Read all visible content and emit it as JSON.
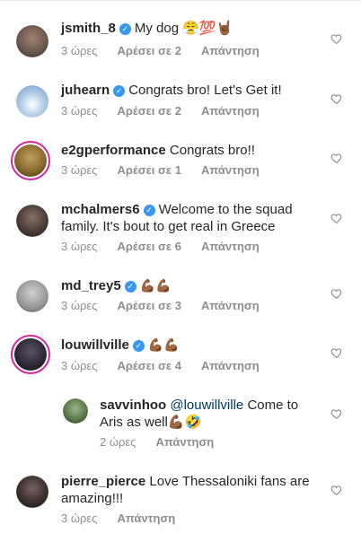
{
  "comments": [
    {
      "username": "jsmith_8",
      "verified": true,
      "text": "My dog 😤💯🤘🏾",
      "time": "3 ώρες",
      "likes": "Αρέσει σε 2",
      "reply": "Απάντηση",
      "avatar_color": "#6b5a4e"
    },
    {
      "username": "juhearn",
      "verified": true,
      "text": "Congrats bro! Let's Get it!",
      "time": "3 ώρες",
      "likes": "Αρέσει σε 2",
      "reply": "Απάντηση",
      "avatar_color": "#8fb3d9"
    },
    {
      "username": "e2gperformance",
      "verified": false,
      "text": "Congrats bro!!",
      "time": "3 ώρες",
      "likes": "Αρέσει σε 1",
      "reply": "Απάντηση",
      "avatar_color": "#8a6a2e"
    },
    {
      "username": "mchalmers6",
      "verified": true,
      "text": "Welcome to the squad family. It's bout to get real in Greece",
      "time": "3 ώρες",
      "likes": "Αρέσει σε 6",
      "reply": "Απάντηση",
      "avatar_color": "#4a3d38"
    },
    {
      "username": "md_trey5",
      "verified": true,
      "text": "💪🏾💪🏾",
      "time": "3 ώρες",
      "likes": "Αρέσει σε 3",
      "reply": "Απάντηση",
      "avatar_color": "#9b9b9b"
    },
    {
      "username": "louwillville",
      "verified": true,
      "text": "💪🏾💪🏾",
      "time": "3 ώρες",
      "likes": "Αρέσει σε 4",
      "reply": "Απάντηση",
      "avatar_color": "#2e2a36"
    },
    {
      "username": "savvinhoo",
      "verified": false,
      "mention": "@louwillville",
      "text": "Come to Aris as well💪🏾🤣",
      "time": "2 ώρες",
      "reply": "Απάντηση",
      "avatar_color": "#5a7a4a"
    },
    {
      "username": "pierre_pierce",
      "verified": false,
      "text": "Love Thessaloniki fans are amazing!!!",
      "time": "3 ώρες",
      "reply": "Απάντηση",
      "avatar_color": "#3a3030"
    }
  ],
  "colors": {
    "verified": "#3897f0",
    "story_ring": "#d6249f",
    "meta_text": "#8e8e8e",
    "mention": "#00376b"
  },
  "icons": {
    "heart": "heart-outline-icon",
    "verified": "verified-badge-icon"
  }
}
